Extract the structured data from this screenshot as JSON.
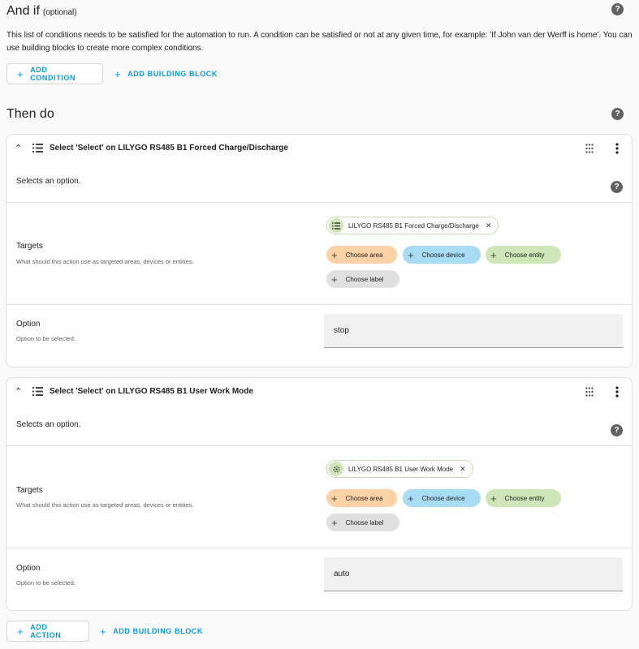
{
  "and_if": {
    "title": "And if",
    "optional": "(optional)",
    "description": "This list of conditions needs to be satisfied for the automation to run. A condition can be satisfied or not at any given time, for example: 'If John van der Werff is home'. You can use building blocks to create more complex conditions.",
    "add_condition": "ADD CONDITION",
    "add_building_block": "ADD BUILDING BLOCK"
  },
  "then_do": {
    "title": "Then do",
    "actions": [
      {
        "title": "Select 'Select' on LILYGO RS485 B1 Forced Charge/Discharge",
        "description": "Selects an option.",
        "targets_label": "Targets",
        "targets_sub": "What should this action use as targeted areas, devices or entities.",
        "entity_chip": "LILYGO RS485 B1 Forced Charge/Discharge",
        "entity_icon": "list-icon",
        "choose_area": "Choose area",
        "choose_device": "Choose device",
        "choose_entity": "Choose entity",
        "choose_label": "Choose label",
        "option_label": "Option",
        "option_sub": "Option to be selected.",
        "option_value": "stop"
      },
      {
        "title": "Select 'Select' on LILYGO RS485 B1 User Work Mode",
        "description": "Selects an option.",
        "targets_label": "Targets",
        "targets_sub": "What should this action use as targeted areas, devices or entities.",
        "entity_chip": "LILYGO RS485 B1 User Work Mode",
        "entity_icon": "cog-icon",
        "choose_area": "Choose area",
        "choose_device": "Choose device",
        "choose_entity": "Choose entity",
        "choose_label": "Choose label",
        "option_label": "Option",
        "option_sub": "Option to be selected.",
        "option_value": "auto"
      }
    ],
    "add_action": "ADD ACTION",
    "add_building_block": "ADD BUILDING BLOCK"
  },
  "colors": {
    "accent": "#039be5",
    "area": "#fdd2a4",
    "device": "#a8dcf4",
    "entity": "#cfe6b8",
    "label": "#e0e0e0"
  }
}
